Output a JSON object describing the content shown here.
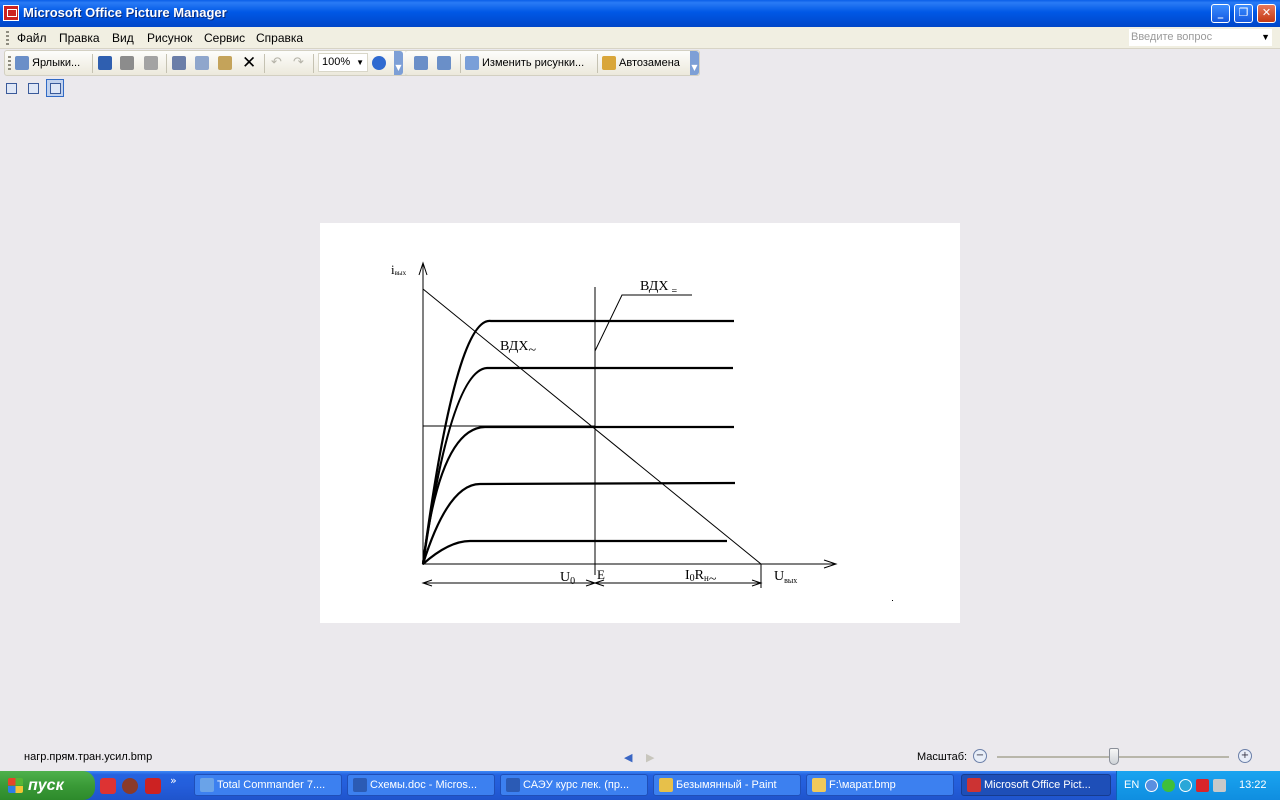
{
  "window": {
    "title": "Microsoft Office Picture Manager"
  },
  "menu": {
    "items": [
      "Файл",
      "Правка",
      "Вид",
      "Рисунок",
      "Сервис",
      "Справка"
    ],
    "ask_placeholder": "Введите вопрос"
  },
  "toolbar": {
    "shortcuts_label": "Ярлыки...",
    "zoom": "100%",
    "edit_label": "Изменить рисунки...",
    "autocorrect_label": "Автозамена"
  },
  "image": {
    "axis_y": "i",
    "axis_y_sub": "вых",
    "axis_x": "U",
    "axis_x_sub": "вых",
    "label_ac": "ВДХ",
    "label_ac_suffix": "~",
    "label_dc": "ВДХ",
    "label_dc_suffix": "=",
    "label_u0": "U",
    "label_u0_sub": "0",
    "label_e": "E",
    "label_i0rn_i": "I",
    "label_i0rn_sub0": "0",
    "label_i0rn_r": "R",
    "label_i0rn_subn": "н",
    "label_i0rn_tilde": "~"
  },
  "status": {
    "filename": "нагр.прям.тран.усил.bmp",
    "scale_label": "Масштаб:"
  },
  "taskbar": {
    "start_label": "пуск",
    "tasks": [
      "Total Commander 7....",
      "Схемы.doc - Micros...",
      "САЭУ курс лек. (пр...",
      "Безымянный - Paint",
      "F:\\марат.bmp",
      "Microsoft Office Pict..."
    ],
    "lang": "EN",
    "clock": "13:22"
  },
  "colors": {
    "titlebar": "#0058e6",
    "taskbar": "#245edb",
    "start": "#3a9a37",
    "canvas_bg": "#ffffff",
    "workspace": "#ebe9ed"
  }
}
